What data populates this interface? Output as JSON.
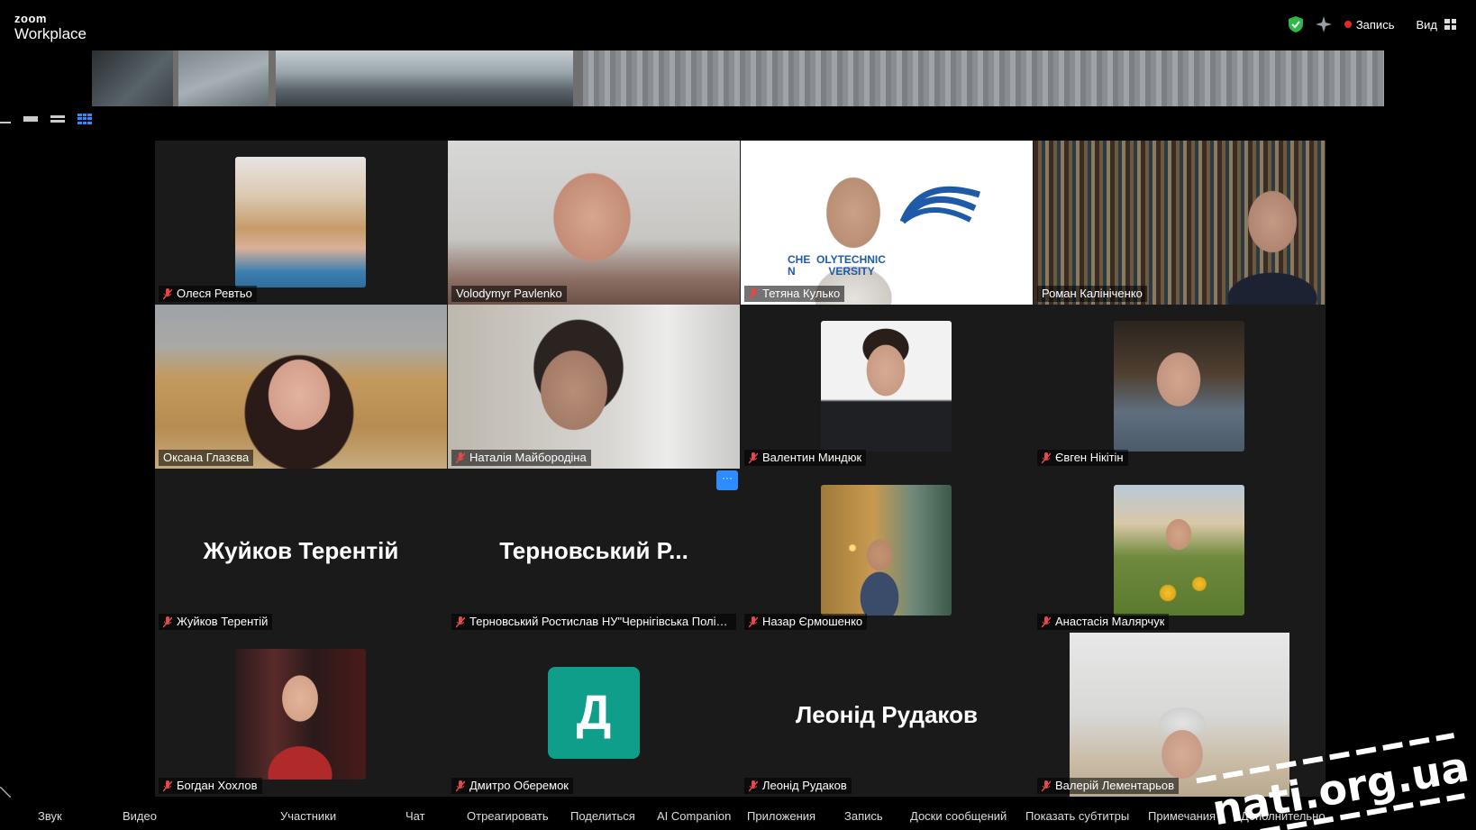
{
  "app": {
    "logo_line1": "zoom",
    "logo_line2": "Workplace"
  },
  "topbar": {
    "record_label": "Запись",
    "view_label": "Вид"
  },
  "colors": {
    "accent": "#2d8cff",
    "speaking": "#23d160",
    "record": "#e02828",
    "avatar_bg": "#0e9e8a",
    "mic_muted": "#e24a4a"
  },
  "participants": [
    {
      "name": "Олеся Ревтьо",
      "muted": true
    },
    {
      "name": "Volodymyr Pavlenko",
      "muted": false
    },
    {
      "name": "Тетяна Кулько",
      "muted": true
    },
    {
      "name": "Роман Калініченко",
      "muted": false
    },
    {
      "name": "Оксана Глазєва",
      "muted": false,
      "speaking": true
    },
    {
      "name": "Наталія Майбородіна",
      "muted": true
    },
    {
      "name": "Валентин Миндюк",
      "muted": true
    },
    {
      "name": "Євген Нікітін",
      "muted": true
    },
    {
      "name": "Жуйков Терентій",
      "display": "Жуйков Терентій",
      "muted": true
    },
    {
      "name": "Терновський Ростислав НУ\"Чернігівська Політе...",
      "display": "Терновський Р...",
      "muted": true
    },
    {
      "name": "Назар Єрмошенко",
      "muted": true
    },
    {
      "name": "Анастасія Малярчук",
      "muted": true
    },
    {
      "name": "Богдан Хохлов",
      "muted": true
    },
    {
      "name": "Дмитро Оберемок",
      "avatar_letter": "Д",
      "muted": true
    },
    {
      "name": "Леонід Рудаков",
      "display": "Леонід Рудаков",
      "muted": true
    },
    {
      "name": "Валерій Лементарьов",
      "muted": true
    }
  ],
  "tile_extras": {
    "more_label": "···",
    "logo_text": "CHE  OLYTECHNIC",
    "logo_text2": "N           VERSITY"
  },
  "toolbar": {
    "audio": "Звук",
    "video": "Видео",
    "participants": "Участники",
    "chat": "Чат",
    "react": "Отреагировать",
    "share": "Поделиться",
    "ai": "AI Companion",
    "apps": "Приложения",
    "record": "Запись",
    "whiteboards": "Доски сообщений",
    "captions": "Показать субтитры",
    "notes": "Примечания",
    "more": "Дополнительно"
  },
  "watermark": {
    "text": "nati.org.ua"
  }
}
